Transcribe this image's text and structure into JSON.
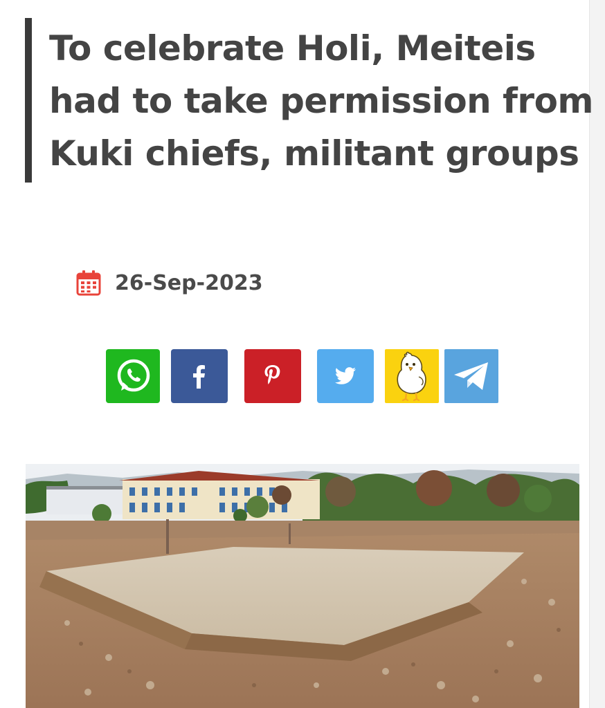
{
  "article": {
    "headline": "To celebrate Holi, Meiteis had to take permission from Kuki chiefs, militant groups",
    "date": "26-Sep-2023",
    "date_icon": "calendar-icon"
  },
  "share": [
    {
      "network": "WhatsApp",
      "icon": "whatsapp-icon",
      "color": "#1fb81f"
    },
    {
      "network": "Facebook",
      "icon": "facebook-icon",
      "color": "#3b5998"
    },
    {
      "network": "Pinterest",
      "icon": "pinterest-icon",
      "color": "#cb2027"
    },
    {
      "network": "Twitter",
      "icon": "twitter-icon",
      "color": "#55acee"
    },
    {
      "network": "Koo",
      "icon": "koo-bird-icon",
      "color": "#fad20f"
    },
    {
      "network": "Telegram",
      "icon": "telegram-icon",
      "color": "#59a4de"
    }
  ],
  "image": {
    "subject": "photo of a bare concrete foundation slab on dirt ground with a building and trees behind"
  },
  "colors": {
    "headline_text": "#444444",
    "accent_bar": "#3a3a3a",
    "calendar_icon": "#e8433a"
  }
}
